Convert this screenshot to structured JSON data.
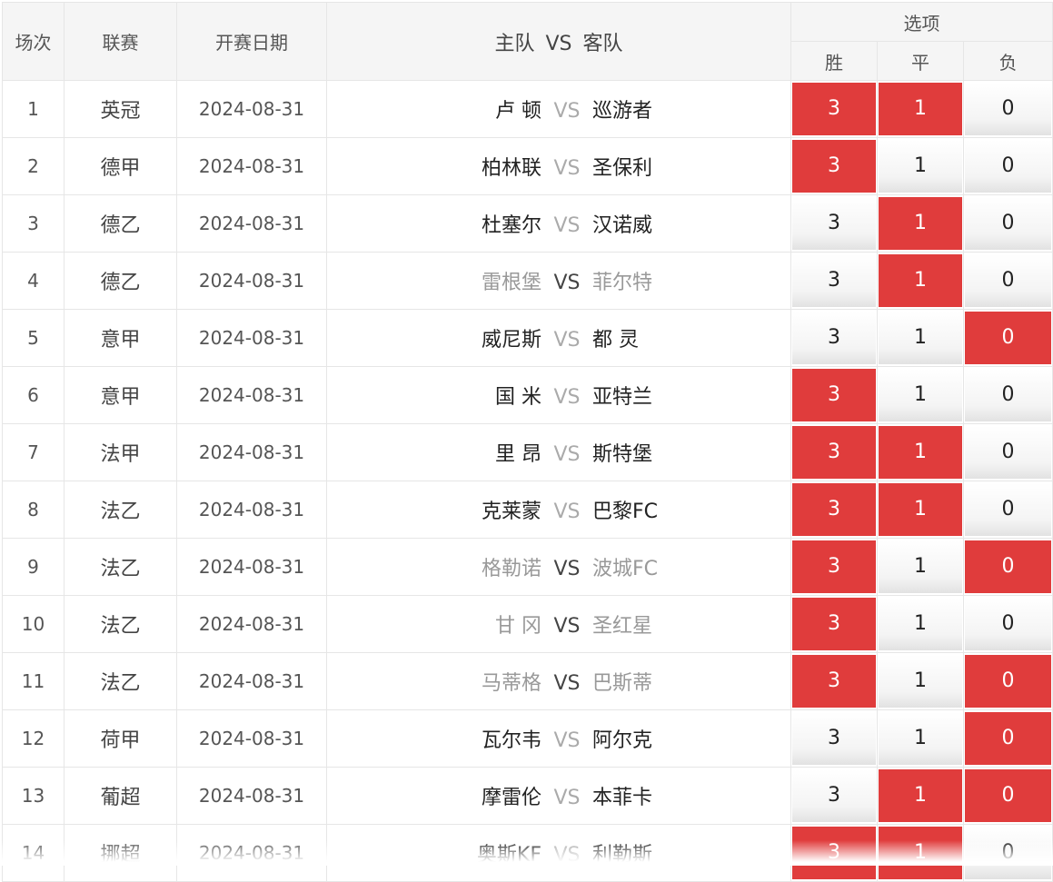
{
  "header": {
    "index_label": "场次",
    "league_label": "联赛",
    "date_label": "开赛日期",
    "home_label": "主队",
    "vs_label": "VS",
    "away_label": "客队",
    "options_label": "选项",
    "win_label": "胜",
    "draw_label": "平",
    "loss_label": "负"
  },
  "colors": {
    "selected": "#e03c3c",
    "muted_team": "#999999"
  },
  "rows": [
    {
      "no": "1",
      "league": "英冠",
      "date": "2024-08-31",
      "home": "卢 顿",
      "away": "巡游者",
      "vs": "VS",
      "muted": false,
      "win": "3",
      "draw": "1",
      "loss": "0",
      "sel": [
        true,
        true,
        false
      ]
    },
    {
      "no": "2",
      "league": "德甲",
      "date": "2024-08-31",
      "home": "柏林联",
      "away": "圣保利",
      "vs": "VS",
      "muted": false,
      "win": "3",
      "draw": "1",
      "loss": "0",
      "sel": [
        true,
        false,
        false
      ]
    },
    {
      "no": "3",
      "league": "德乙",
      "date": "2024-08-31",
      "home": "杜塞尔",
      "away": "汉诺威",
      "vs": "VS",
      "muted": false,
      "win": "3",
      "draw": "1",
      "loss": "0",
      "sel": [
        false,
        true,
        false
      ]
    },
    {
      "no": "4",
      "league": "德乙",
      "date": "2024-08-31",
      "home": "雷根堡",
      "away": "菲尔特",
      "vs": "VS",
      "muted": true,
      "win": "3",
      "draw": "1",
      "loss": "0",
      "sel": [
        false,
        true,
        false
      ]
    },
    {
      "no": "5",
      "league": "意甲",
      "date": "2024-08-31",
      "home": "威尼斯",
      "away": "都 灵",
      "vs": "VS",
      "muted": false,
      "win": "3",
      "draw": "1",
      "loss": "0",
      "sel": [
        false,
        false,
        true
      ]
    },
    {
      "no": "6",
      "league": "意甲",
      "date": "2024-08-31",
      "home": "国 米",
      "away": "亚特兰",
      "vs": "VS",
      "muted": false,
      "win": "3",
      "draw": "1",
      "loss": "0",
      "sel": [
        true,
        false,
        false
      ]
    },
    {
      "no": "7",
      "league": "法甲",
      "date": "2024-08-31",
      "home": "里 昂",
      "away": "斯特堡",
      "vs": "VS",
      "muted": false,
      "win": "3",
      "draw": "1",
      "loss": "0",
      "sel": [
        true,
        true,
        false
      ]
    },
    {
      "no": "8",
      "league": "法乙",
      "date": "2024-08-31",
      "home": "克莱蒙",
      "away": "巴黎FC",
      "vs": "VS",
      "muted": false,
      "win": "3",
      "draw": "1",
      "loss": "0",
      "sel": [
        true,
        true,
        false
      ]
    },
    {
      "no": "9",
      "league": "法乙",
      "date": "2024-08-31",
      "home": "格勒诺",
      "away": "波城FC",
      "vs": "VS",
      "muted": true,
      "win": "3",
      "draw": "1",
      "loss": "0",
      "sel": [
        true,
        false,
        true
      ]
    },
    {
      "no": "10",
      "league": "法乙",
      "date": "2024-08-31",
      "home": "甘 冈",
      "away": "圣红星",
      "vs": "VS",
      "muted": true,
      "win": "3",
      "draw": "1",
      "loss": "0",
      "sel": [
        true,
        false,
        false
      ]
    },
    {
      "no": "11",
      "league": "法乙",
      "date": "2024-08-31",
      "home": "马蒂格",
      "away": "巴斯蒂",
      "vs": "VS",
      "muted": true,
      "win": "3",
      "draw": "1",
      "loss": "0",
      "sel": [
        true,
        false,
        true
      ]
    },
    {
      "no": "12",
      "league": "荷甲",
      "date": "2024-08-31",
      "home": "瓦尔韦",
      "away": "阿尔克",
      "vs": "VS",
      "muted": false,
      "win": "3",
      "draw": "1",
      "loss": "0",
      "sel": [
        false,
        false,
        true
      ]
    },
    {
      "no": "13",
      "league": "葡超",
      "date": "2024-08-31",
      "home": "摩雷伦",
      "away": "本菲卡",
      "vs": "VS",
      "muted": false,
      "win": "3",
      "draw": "1",
      "loss": "0",
      "sel": [
        false,
        true,
        true
      ]
    },
    {
      "no": "14",
      "league": "挪超",
      "date": "2024-08-31",
      "home": "奥斯KF",
      "away": "利勒斯",
      "vs": "VS",
      "muted": false,
      "win": "3",
      "draw": "1",
      "loss": "0",
      "sel": [
        true,
        true,
        false
      ]
    }
  ]
}
